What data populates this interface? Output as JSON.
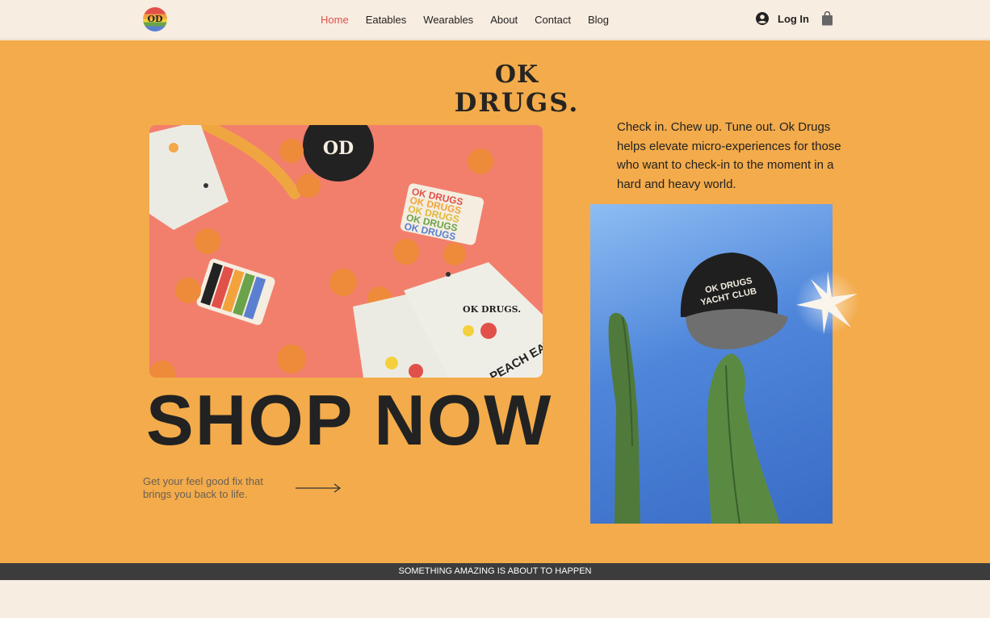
{
  "header": {
    "logo_text": "OD",
    "nav": [
      {
        "label": "Home",
        "active": true
      },
      {
        "label": "Eatables",
        "active": false
      },
      {
        "label": "Wearables",
        "active": false
      },
      {
        "label": "About",
        "active": false
      },
      {
        "label": "Contact",
        "active": false
      },
      {
        "label": "Blog",
        "active": false
      }
    ],
    "login_label": "Log In",
    "login_icon": "user-circle-icon",
    "cart_icon": "shopping-bag-icon"
  },
  "hero": {
    "brand_line1": "OK",
    "brand_line2": "DRUGS.",
    "cta": "SHOP NOW",
    "tagline": "Get your feel good fix that brings you back to life.",
    "intro": "Check in. Chew up. Tune out. Ok Drugs helps elevate micro-experiences for those who want to check-in to the moment in a hard and heavy world.",
    "product_image": {
      "badge_text": "OD",
      "sticker_lines": [
        "OK DRUGS",
        "OK DRUGS",
        "OK DRUGS",
        "OK DRUGS",
        "OK DRUGS"
      ],
      "pouch_brand": "OK DRUGS.",
      "pouch_label": "PEACH EATABLES"
    },
    "cap_image": {
      "cap_text_line1": "OK DRUGS",
      "cap_text_line2": "YACHT CLUB"
    }
  },
  "banner": {
    "text": "SOMETHING AMAZING IS ABOUT TO HAPPEN"
  },
  "colors": {
    "hero_bg": "#f3ab4b",
    "page_bg": "#f8ede1",
    "accent": "#e2504a",
    "banner_bg": "#3c3c3c"
  }
}
